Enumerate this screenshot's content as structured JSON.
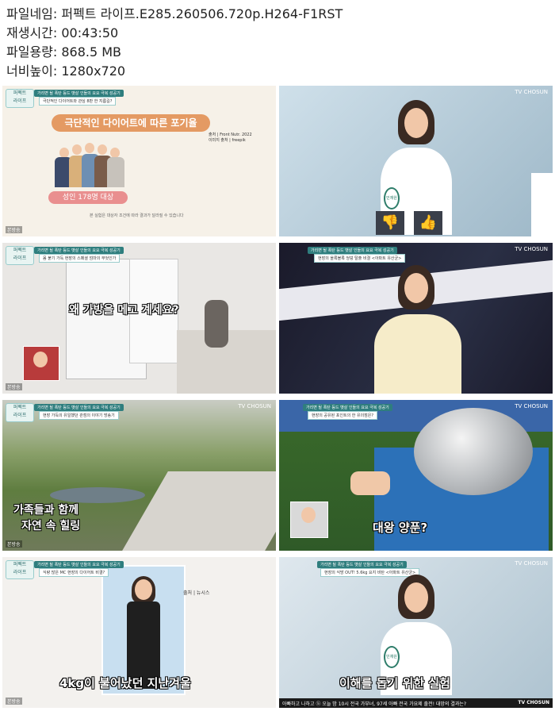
{
  "meta": {
    "lines": [
      "파일네임: 퍼펙트 라이프.E285.260506.720p.H264-F1RST",
      "재생시간: 00:43:50",
      "파일용량: 868.5 MB",
      "너비높이: 1280x720"
    ]
  },
  "thumbs": {
    "t1": {
      "top_caption": "가리면 될 폭탄 등드 뱃살 인들의 요요 극복 성공기",
      "sub_caption": "극단적인 다이어트와 관심 8판 한 지름길?",
      "title": "극단적인 다이어트에 따른 포기율",
      "source": "출처 | Front Nutr. 2022",
      "photo_source": "이미지 출처 | freepik",
      "pill": "성인 178명 대상",
      "footnote": "본 실험은 대상자 조건에 따라 결과가 달라질 수 있습니다",
      "bon": "본방송"
    },
    "t2": {
      "channel": "TV CHOSUN",
      "nametag": "민재원"
    },
    "t3": {
      "top_caption": "가리면 될 폭탄 등드 뱃살 인들의 요요 극복 성공기",
      "sub_caption": "몸 붙기 가득 현장의 스페셜 엄마의 무엇인가",
      "subtitle": "왜 가방을 메고 계세요?",
      "bon": "본방송"
    },
    "t4": {
      "channel": "TV CHOSUN",
      "top_caption": "가리면 될 폭탄 등드 뱃살 인들의 요요 극복 성공기",
      "sub_caption": "현장의 올록볼록 엉덩 탈출 비결 <아파트 유산균>"
    },
    "t5": {
      "channel": "TV CHOSUN",
      "top_caption": "가리면 될 폭탄 등드 뱃살 인들의 요요 극복 성공기",
      "sub_caption": "현장 가득의 유일했던 관점의 이야기 방송기",
      "subtitle1": "가족들과 함께",
      "subtitle2": "자연 속 힐링",
      "bon": "본방송"
    },
    "t6": {
      "channel": "TV CHOSUN",
      "top_caption": "가리면 될 폭탄 등드 뱃살 인들의 요요 극복 성공기",
      "sub_caption": "현장의 공유된 포인트의 한 유의점은?",
      "subtitle": "대왕 양푼?"
    },
    "t7": {
      "top_caption": "가리면 될 폭탄 등드 뱃살 인들의 요요 극복 성공기",
      "sub_caption": "식량 많은 MC 현장의 다이어트 비결?",
      "source": "출처 | 뉴시스",
      "subtitle": "4kg이 불어났던 지난겨울",
      "bon": "본방송"
    },
    "t8": {
      "channel": "TV CHOSUN",
      "top_caption": "가리면 될 폭탄 등드 뱃살 인들의 요요 극복 성공기",
      "sub_caption": "현장의 식망 OUT! 5.6kg 요지 비탄 <아파트 유산균>",
      "nametag": "민재원",
      "subtitle": "이해를 돕기 위한 실험",
      "ticker": "아빠하고 나하고 ⓑ 오늘 밤 10시 전국 가부녀, 97세 아빠 전국 가요제 출전! 대망의 결과는?",
      "ticker_brand": "TV CHOSUN"
    }
  }
}
